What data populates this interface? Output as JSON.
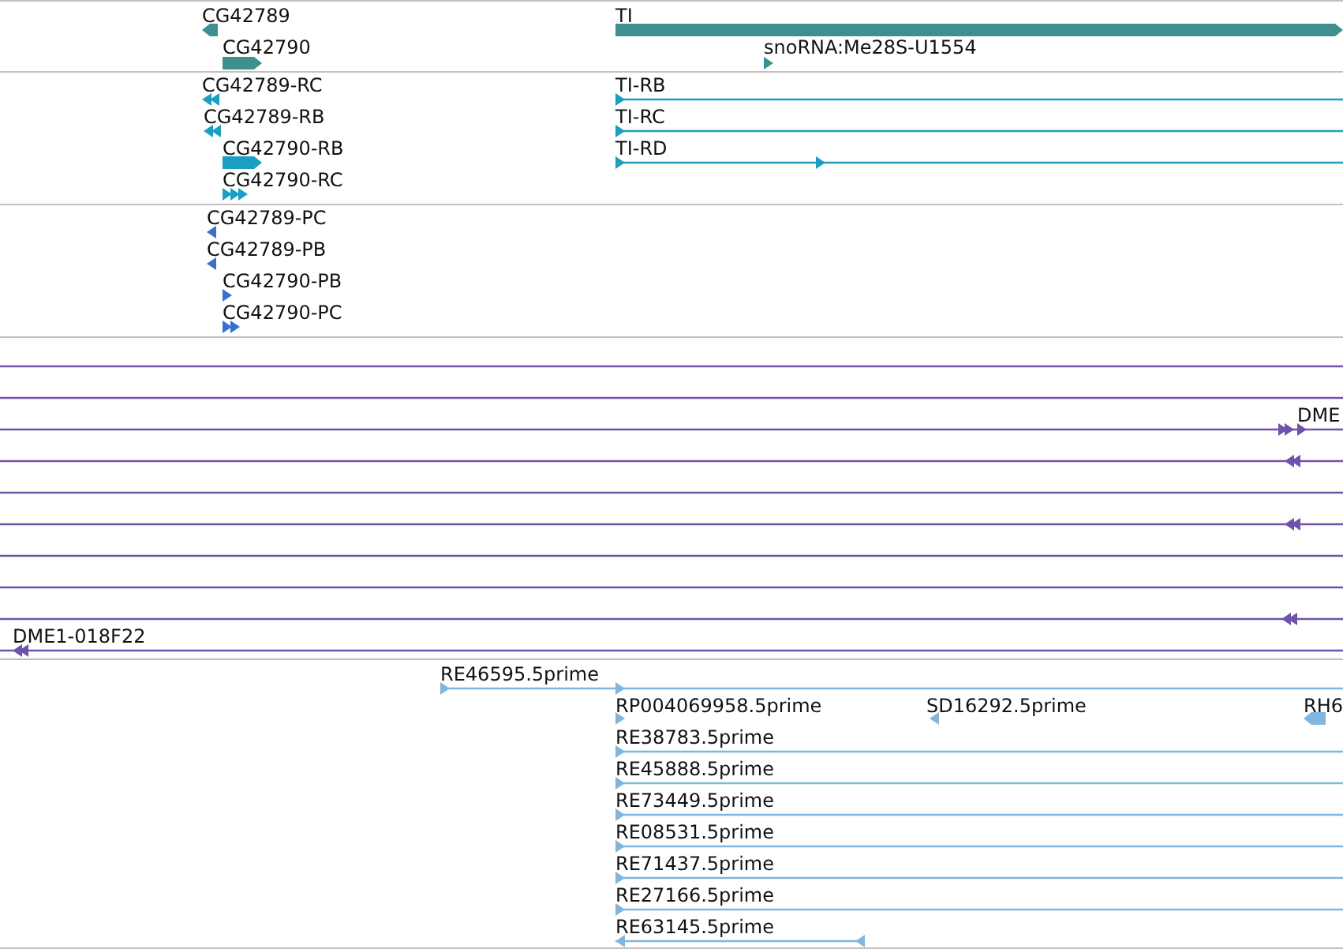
{
  "tracks": [
    {
      "color": "#3f8f91",
      "features": [
        {
          "label": "CG42789",
          "kind": "block",
          "reverse": true
        },
        {
          "label": "CG42790",
          "kind": "block",
          "reverse": false
        },
        {
          "label": "TI",
          "kind": "block",
          "reverse": false
        },
        {
          "label": "snoRNA:Me28S-U1554",
          "kind": "tick",
          "reverse": false
        }
      ]
    },
    {
      "color": "#1a9fc0",
      "features": [
        {
          "label": "CG42789-RC",
          "kind": "arrows",
          "reverse": true
        },
        {
          "label": "CG42789-RB",
          "kind": "arrows",
          "reverse": true
        },
        {
          "label": "CG42790-RB",
          "kind": "block",
          "reverse": false
        },
        {
          "label": "CG42790-RC",
          "kind": "arrows",
          "reverse": false
        },
        {
          "label": "TI-RB",
          "kind": "line",
          "reverse": false
        },
        {
          "label": "TI-RC",
          "kind": "line",
          "reverse": false
        },
        {
          "label": "TI-RD",
          "kind": "line",
          "reverse": false
        }
      ]
    },
    {
      "color": "#3a6fd2",
      "features": [
        {
          "label": "CG42789-PC",
          "kind": "arrows",
          "reverse": true
        },
        {
          "label": "CG42789-PB",
          "kind": "arrows",
          "reverse": true
        },
        {
          "label": "CG42790-PB",
          "kind": "tick",
          "reverse": false
        },
        {
          "label": "CG42790-PC",
          "kind": "arrows",
          "reverse": false
        }
      ]
    },
    {
      "color": "#7052aa",
      "features": [
        {
          "kind": "line"
        },
        {
          "kind": "line"
        },
        {
          "label": "DME",
          "kind": "line",
          "reverse": false
        },
        {
          "kind": "line",
          "reverse": true
        },
        {
          "kind": "line"
        },
        {
          "kind": "line",
          "reverse": true
        },
        {
          "kind": "line"
        },
        {
          "kind": "line"
        },
        {
          "kind": "line",
          "reverse": true
        },
        {
          "label": "DME1-018F22",
          "kind": "line",
          "reverse": true
        }
      ]
    },
    {
      "color": "#80b6dd",
      "features": [
        {
          "label": "RE46595.5prime",
          "kind": "line",
          "reverse": false
        },
        {
          "label": "RP004069958.5prime",
          "kind": "tick",
          "reverse": false
        },
        {
          "label": "SD16292.5prime",
          "kind": "tick",
          "reverse": true
        },
        {
          "label": "RH6",
          "kind": "block",
          "reverse": true
        },
        {
          "label": "RE38783.5prime",
          "kind": "line",
          "reverse": false
        },
        {
          "label": "RE45888.5prime",
          "kind": "line",
          "reverse": false
        },
        {
          "label": "RE73449.5prime",
          "kind": "line",
          "reverse": false
        },
        {
          "label": "RE08531.5prime",
          "kind": "line",
          "reverse": false
        },
        {
          "label": "RE71437.5prime",
          "kind": "line",
          "reverse": false
        },
        {
          "label": "RE27166.5prime",
          "kind": "line",
          "reverse": false
        },
        {
          "label": "RE63145.5prime",
          "kind": "line",
          "reverse": true
        }
      ]
    }
  ]
}
